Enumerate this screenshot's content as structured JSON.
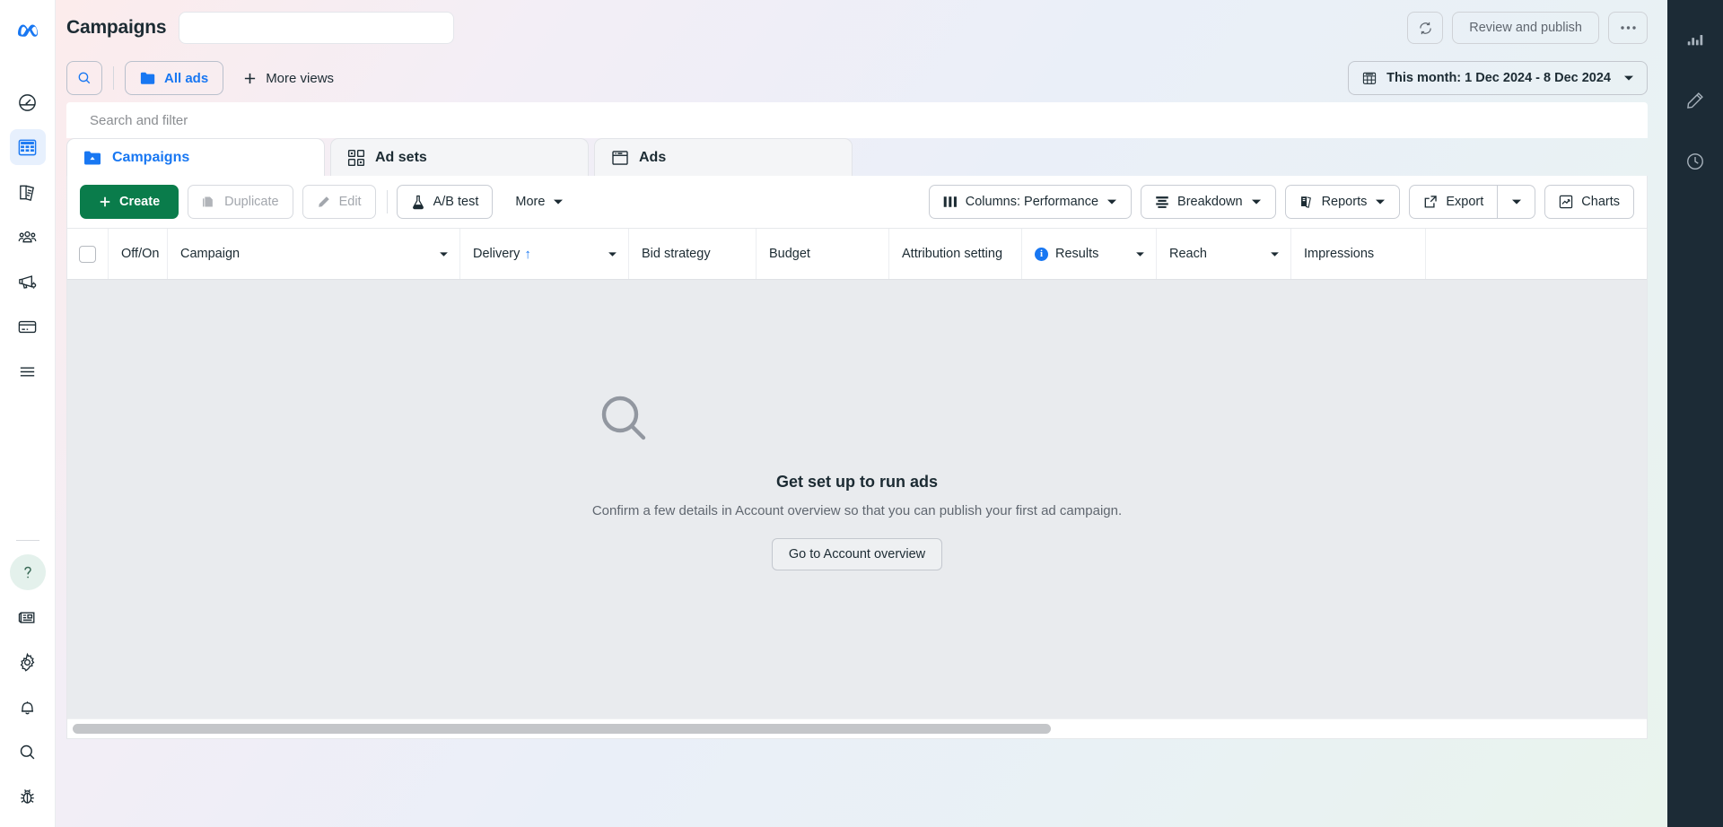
{
  "header": {
    "title": "Campaigns",
    "account_field_value": "",
    "refresh_icon": "refresh-icon",
    "review_publish_label": "Review and publish",
    "more_options_label": "•••"
  },
  "views": {
    "search_icon": "search-icon",
    "all_ads_label": "All ads",
    "more_views_label": "More views",
    "date_range_label": "This month: 1 Dec 2024 - 8 Dec 2024"
  },
  "search": {
    "placeholder": "Search and filter"
  },
  "tabs": [
    {
      "label": "Campaigns",
      "icon": "campaigns-folder-icon",
      "active": true
    },
    {
      "label": "Ad sets",
      "icon": "ad-sets-grid-icon",
      "active": false
    },
    {
      "label": "Ads",
      "icon": "ads-window-icon",
      "active": false
    }
  ],
  "toolbar": {
    "create_label": "Create",
    "duplicate_label": "Duplicate",
    "edit_label": "Edit",
    "ab_test_label": "A/B test",
    "more_label": "More",
    "columns_label": "Columns: Performance",
    "breakdown_label": "Breakdown",
    "reports_label": "Reports",
    "export_label": "Export",
    "charts_label": "Charts"
  },
  "table": {
    "columns": [
      {
        "key": "checkbox",
        "label": ""
      },
      {
        "key": "offon",
        "label": "Off/On"
      },
      {
        "key": "campaign",
        "label": "Campaign"
      },
      {
        "key": "delivery",
        "label": "Delivery"
      },
      {
        "key": "bid",
        "label": "Bid strategy"
      },
      {
        "key": "budget",
        "label": "Budget"
      },
      {
        "key": "attribution",
        "label": "Attribution setting"
      },
      {
        "key": "results",
        "label": "Results"
      },
      {
        "key": "reach",
        "label": "Reach"
      },
      {
        "key": "impressions",
        "label": "Impressions"
      }
    ],
    "sorted_column": "Delivery",
    "sort_direction": "↑",
    "rows": []
  },
  "empty_state": {
    "icon": "magnifier-icon",
    "title": "Get set up to run ads",
    "subtitle": "Confirm a few details in Account overview so that you can publish your first ad campaign.",
    "button_label": "Go to Account overview"
  },
  "left_rail": {
    "logo": "meta-logo",
    "items": [
      {
        "name": "account-overview",
        "icon": "gauge-icon",
        "active": false
      },
      {
        "name": "campaigns",
        "icon": "table-icon",
        "active": true
      },
      {
        "name": "billing",
        "icon": "pages-icon",
        "active": false
      },
      {
        "name": "audiences",
        "icon": "audiences-icon",
        "active": false
      },
      {
        "name": "ads-reporting",
        "icon": "megaphone-icon",
        "active": false
      },
      {
        "name": "payments",
        "icon": "credit-card-icon",
        "active": false
      },
      {
        "name": "all-tools",
        "icon": "hamburger-icon",
        "active": false
      },
      {
        "name": "help",
        "icon": "question-mark-icon",
        "active": false
      },
      {
        "name": "news",
        "icon": "news-card-icon",
        "active": false
      },
      {
        "name": "settings",
        "icon": "gear-icon",
        "active": false
      },
      {
        "name": "notifications",
        "icon": "bell-icon",
        "active": false
      },
      {
        "name": "search",
        "icon": "search-icon",
        "active": false
      },
      {
        "name": "bug-report",
        "icon": "bug-icon",
        "active": false
      }
    ]
  },
  "right_rail": {
    "items": [
      {
        "name": "analytics",
        "icon": "bar-chart-icon"
      },
      {
        "name": "edit",
        "icon": "pencil-icon"
      },
      {
        "name": "history",
        "icon": "clock-icon"
      }
    ]
  },
  "colors": {
    "accent_blue": "#1877f2",
    "create_green": "#0a7c4b",
    "dark_rail": "#1c2b36",
    "table_empty_bg": "#e9ebee"
  },
  "scrollbar": {
    "orientation": "horizontal"
  }
}
